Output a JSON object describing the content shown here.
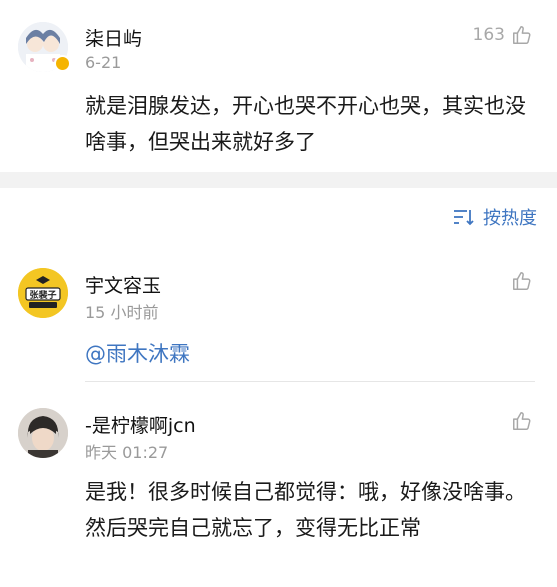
{
  "comments": [
    {
      "username": "柒日屿",
      "time": "6-21",
      "likes": "163",
      "text": "就是泪腺发达，开心也哭不开心也哭，其实也没啥事，但哭出来就好多了",
      "verified_badge": true
    },
    {
      "username": "宇文容玉",
      "time": "15 小时前",
      "likes": "",
      "mention": "@雨木沐霖",
      "avatar_text": "张裴子"
    },
    {
      "username": "-是柠檬啊jcn",
      "time": "昨天 01:27",
      "likes": "",
      "text": "是我！很多时候自己都觉得：哦，好像没啥事。然后哭完自己就忘了，变得无比正常"
    }
  ],
  "sort": {
    "label": "按热度",
    "icon": "sort-icon"
  },
  "colors": {
    "link": "#3f76c1",
    "muted": "#9a9a9a",
    "band": "#f2f2f2",
    "badge": "#f5b400"
  }
}
